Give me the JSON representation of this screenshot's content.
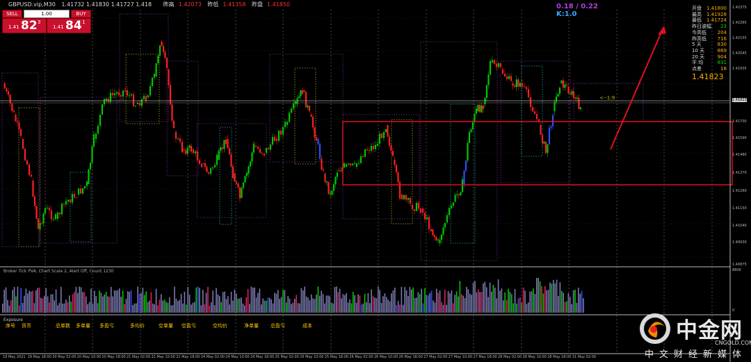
{
  "title_bar": {
    "symbol": "GBPUSD.vip,M30",
    "ohlc": "1.41732 1.41830 1.41727 1.418",
    "labels": [
      {
        "name": "昨高",
        "value": "1.42073"
      },
      {
        "name": "昨低",
        "value": "1.41358"
      },
      {
        "name": "昨盘",
        "value": "1.41850"
      }
    ]
  },
  "one_click": {
    "sell_label": "SELL",
    "buy_label": "BUY",
    "lot": "1.00",
    "sell_prefix": "1.41",
    "sell_big": "82",
    "sell_sup": "3",
    "buy_prefix": "1.41",
    "buy_big": "84",
    "buy_sup": "1"
  },
  "k_info": {
    "line1": "0.18 / 0.22",
    "line2": "K:1.0"
  },
  "info_panel": [
    {
      "label": "开盘",
      "value": "1.41800",
      "color": "#ffb000"
    },
    {
      "label": "最高",
      "value": "1.41928",
      "color": "#ffb000"
    },
    {
      "label": "最低",
      "value": "1.41724",
      "color": "#ffb000"
    },
    {
      "label": "昨日波幅",
      "value": "23",
      "color": "#00e000"
    },
    {
      "label": "今高低",
      "value": "204",
      "color": "#ffb000"
    },
    {
      "label": "昨高低",
      "value": "716",
      "color": "#ffb000"
    },
    {
      "label": "5 天",
      "value": "830",
      "color": "#ffb000"
    },
    {
      "label": "10 天",
      "value": "869",
      "color": "#ffb000"
    },
    {
      "label": "20 天",
      "value": "904",
      "color": "#ffb000"
    },
    {
      "label": "平 均",
      "value": "831",
      "color": "#00e000"
    },
    {
      "label": "点差",
      "value": "18",
      "color": "#ffb000"
    }
  ],
  "current_price_big": "1.41823",
  "price_scale": [
    "1.42375",
    "1.42265",
    "1.42155",
    "1.42045",
    "1.41935",
    "1.41823",
    "1.41700",
    "1.41590",
    "1.41480",
    "1.41370",
    "1.41260",
    "1.41150",
    "1.41040",
    "1.40930"
  ],
  "price_scale_bottom": "1.40875",
  "fib_label": "<--1:9",
  "sub_window": {
    "header": "Broker Tick PVA;  Chart Scale 2,  Alert Off,  Count 1230",
    "scale_top": "8806",
    "scale_bottom": "0"
  },
  "exposure": {
    "title": "Exposure",
    "columns": [
      "序号",
      "货币",
      "总单数",
      "多单量",
      "多盈亏",
      "多均价",
      "空单量",
      "空盈亏",
      "空均价",
      "净单量",
      "总盈亏",
      "成本"
    ]
  },
  "time_axis": [
    "19 May 2021",
    "19 May 18:00",
    "20 May 02:00",
    "20 May 10:00",
    "20 May 18:00",
    "21 May 02:00",
    "21 May 10:00",
    "21 May 18:00",
    "24 May 02:00",
    "24 May 10:00",
    "24 May 18:00",
    "25 May 02:00",
    "25 May 10:00",
    "25 May 18:00",
    "26 May 02:00",
    "26 May 10:00",
    "26 May 18:00",
    "27 May 02:00",
    "27 May 10:00",
    "27 May 18:00",
    "28 May 02:00",
    "28 May 10:00",
    "28 May 18:00",
    "31 May 02:00"
  ],
  "watermark": {
    "brand_cn": "中金网",
    "url": "CNGOLD.COM.CN",
    "tagline": "中文财经新媒体"
  },
  "colors": {
    "bull": "#00c800",
    "bear": "#ff2020",
    "vwap_bull": "#3050ff",
    "box": "#e01020",
    "arrow": "#e01020"
  }
}
